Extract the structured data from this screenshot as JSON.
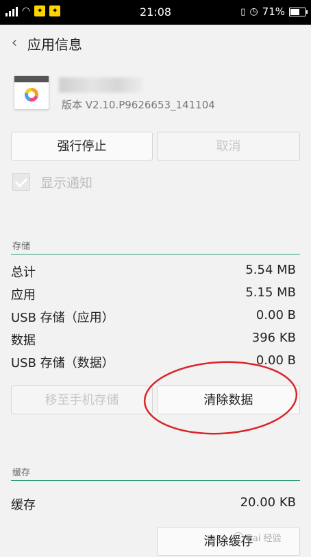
{
  "status_bar": {
    "time": "21:08",
    "battery": "71%",
    "battery_level": 0.71,
    "badge_1": "✦",
    "badge_2": "✦"
  },
  "header": {
    "title": "应用信息",
    "back_icon": "chevron-left-icon"
  },
  "app": {
    "version": "版本 V2.10.P9626653_141104"
  },
  "actions": {
    "force_stop": "强行停止",
    "cancel": "取消"
  },
  "notifications": {
    "label": "显示通知",
    "checked": true
  },
  "storage": {
    "section_label": "存储",
    "rows": [
      {
        "label": "总计",
        "value": "5.54 MB"
      },
      {
        "label": "应用",
        "value": "5.15 MB"
      },
      {
        "label": "USB 存储（应用）",
        "value": "0.00 B"
      },
      {
        "label": "数据",
        "value": "396 KB"
      },
      {
        "label": "USB 存储（数据）",
        "value": "0.00 B"
      }
    ],
    "move_button": "移至手机存储",
    "clear_data_button": "清除数据"
  },
  "cache": {
    "section_label": "缓存",
    "rows": [
      {
        "label": "缓存",
        "value": "20.00 KB"
      }
    ],
    "clear_cache_button": "清除缓存"
  },
  "watermark": {
    "text": "Bai 经验"
  },
  "colors": {
    "accent_line": "#2f9a7a",
    "annotation_circle": "#d9262a"
  }
}
